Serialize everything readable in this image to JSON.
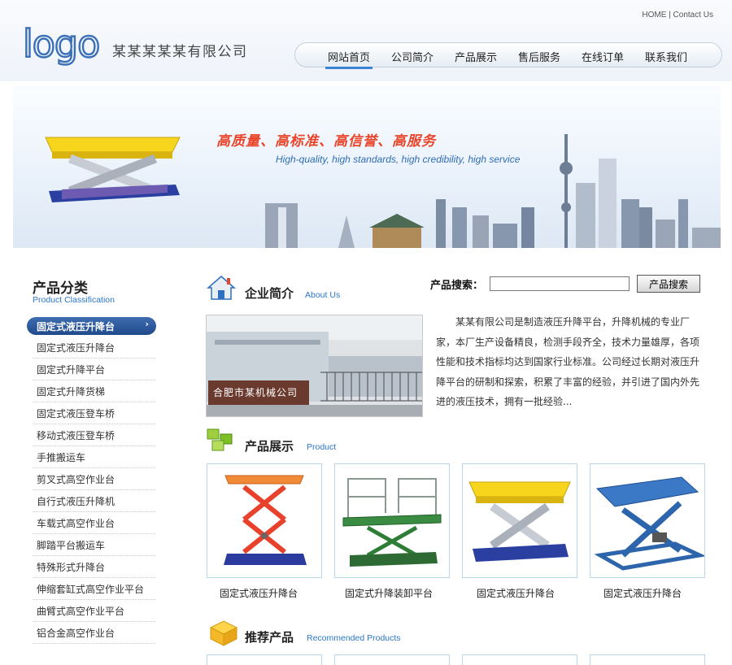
{
  "header": {
    "logo_text": "logo",
    "company_name": "某某某某某有限公司",
    "top_links": {
      "home": "HOME",
      "separator": "|",
      "contact": "Contact Us"
    }
  },
  "nav": {
    "items": [
      "网站首页",
      "公司简介",
      "产品展示",
      "售后服务",
      "在线订单",
      "联系我们"
    ],
    "active_index": 0
  },
  "banner": {
    "slogan_cn": "高质量、高标准、高信誉、高服务",
    "slogan_en": "High-quality, high standards, high credibility, high service"
  },
  "sidebar": {
    "title": "产品分类",
    "subtitle": "Product Classification",
    "active_item": "固定式液压升降台",
    "items": [
      "固定式液压升降台",
      "固定式升降平台",
      "固定式升降货梯",
      "固定式液压登车桥",
      "移动式液压登车桥",
      "手推搬运车",
      "剪叉式高空作业台",
      "自行式液压升降机",
      "车载式高空作业台",
      "脚踏平台搬运车",
      "特殊形式升降台",
      "伸缩套缸式高空作业平台",
      "曲臂式高空作业平台",
      "铝合金高空作业台"
    ]
  },
  "search": {
    "label": "产品搜索：",
    "placeholder": "",
    "button": "产品搜索"
  },
  "about": {
    "title": "企业简介",
    "subtitle": "About Us",
    "photo_caption": "合肥市某机械公司",
    "text": "某某有限公司是制造液压升降平台，升降机械的专业厂家，本厂生产设备精良，检测手段齐全，技术力量雄厚，各项性能和技术指标均达到国家行业标准。公司经过长期对液压升降平台的研制和探索，积累了丰富的经验，并引进了国内外先进的液压技术，拥有一批经验..."
  },
  "products": {
    "title": "产品展示",
    "subtitle": "Product",
    "items": [
      {
        "name": "固定式液压升降台",
        "image": "orange-scissor-lift"
      },
      {
        "name": "固定式升降装卸平台",
        "image": "green-loading-platform"
      },
      {
        "name": "固定式液压升降台",
        "image": "yellow-table-lift"
      },
      {
        "name": "固定式液压升降台",
        "image": "blue-scissor-lift"
      }
    ]
  },
  "recommended": {
    "title": "推荐产品",
    "subtitle": "Recommended Products"
  },
  "colors": {
    "accent_blue": "#2a77c9",
    "nav_active": "#3c83d3",
    "slogan_red": "#e9452b",
    "sidebar_active": "#2b5a9f"
  }
}
